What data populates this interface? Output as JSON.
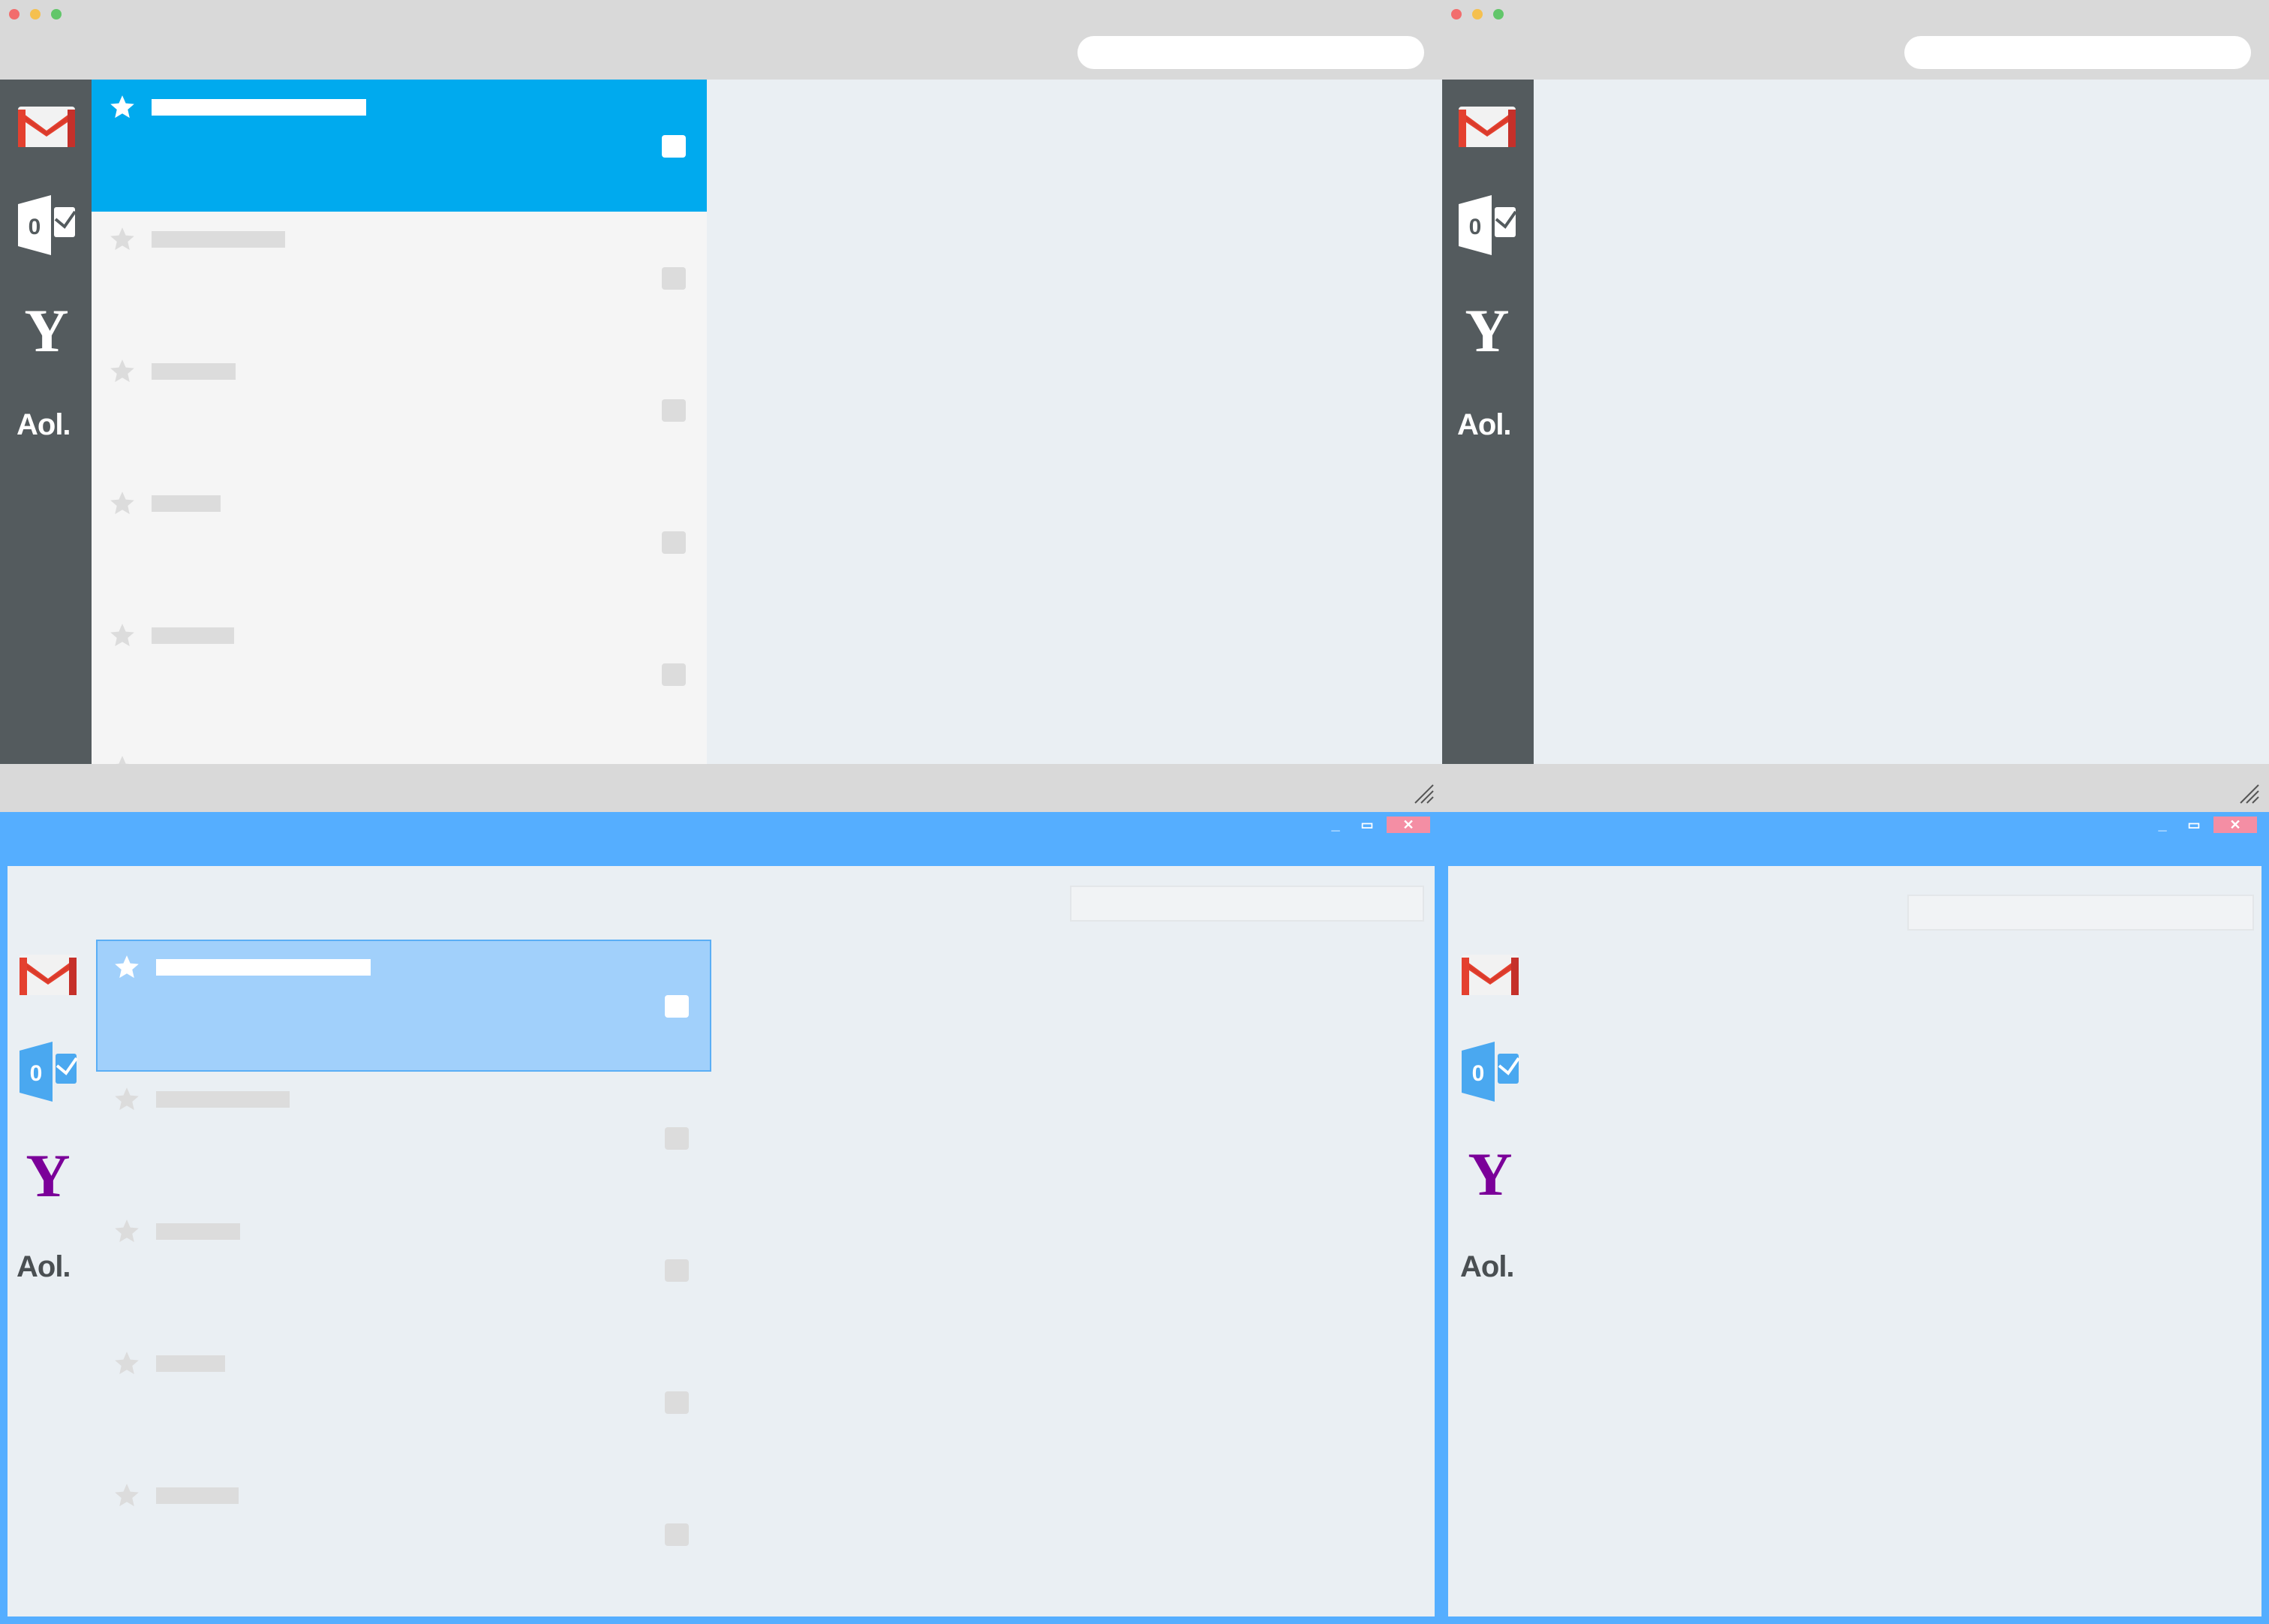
{
  "colors": {
    "mac_titlebar": "#d9d9d9",
    "mac_sidebar": "#545b5e",
    "mac_selected": "#00aaee",
    "content_bg": "#eaeff3",
    "list_bg": "#f5f5f5",
    "win_frame": "#55aeff",
    "win_selected": "#a1d0fb",
    "close_button": "#f48ea4",
    "traffic_red": "#f26d6d",
    "traffic_yellow": "#f5c04f",
    "traffic_green": "#62c66a",
    "yahoo_purple": "#7b0099",
    "gmail_red": "#e4402f",
    "outlook_blue": "#4aa8f0"
  },
  "accounts": [
    {
      "name": "gmail",
      "icon": "gmail-icon"
    },
    {
      "name": "outlook",
      "icon": "outlook-icon",
      "glyph": "0"
    },
    {
      "name": "yahoo",
      "icon": "yahoo-icon",
      "glyph": "Y"
    },
    {
      "name": "aol",
      "icon": "aol-logo",
      "label": "Aol."
    }
  ],
  "window_controls": {
    "minimize": "_",
    "maximize": "▭",
    "close": "✕"
  }
}
